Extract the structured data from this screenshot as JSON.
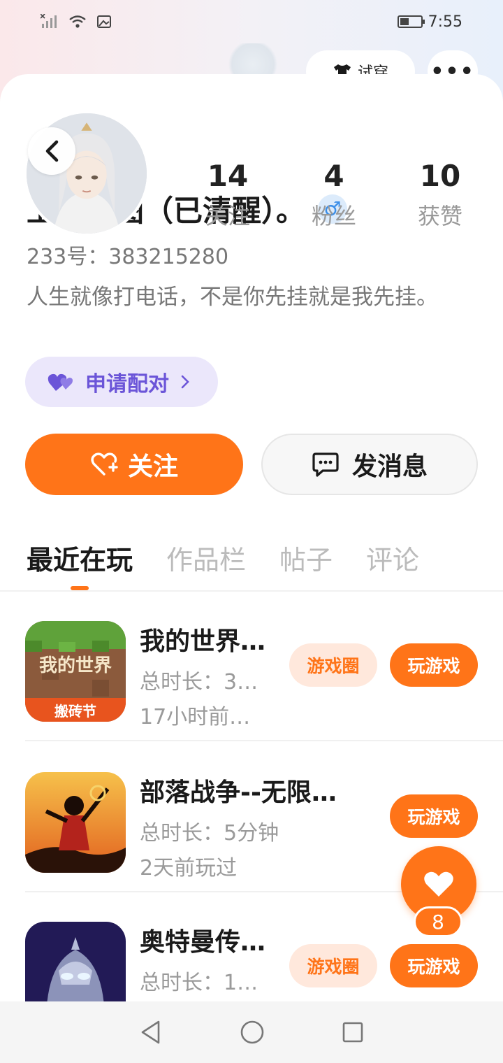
{
  "status_bar": {
    "time": "7:55"
  },
  "header": {
    "peek_pill_label": "试穿",
    "more_label": "•••"
  },
  "profile": {
    "stats": [
      {
        "value": "14",
        "label": "关注"
      },
      {
        "value": "4",
        "label": "粉丝"
      },
      {
        "value": "10",
        "label": "获赞"
      }
    ],
    "name": "上官修图（已清醒）。",
    "gender_symbol": "♂",
    "user_id": "233号：383215280",
    "bio": "人生就像打电话，不是你先挂就是我先挂。",
    "match_button": "申请配对",
    "follow_button": "关注",
    "message_button": "发消息"
  },
  "tabs": [
    {
      "label": "最近在玩",
      "active": true
    },
    {
      "label": "作品栏",
      "active": false
    },
    {
      "label": "帖子",
      "active": false
    },
    {
      "label": "评论",
      "active": false
    }
  ],
  "games": [
    {
      "title": "我的世界…",
      "duration": "总时长：3…",
      "last_played": "17小时前…",
      "circle_label": "游戏圈",
      "play_label": "玩游戏",
      "icon_text_top": "我的世界",
      "icon_text_bottom": "搬砖节"
    },
    {
      "title": "部落战争--无限…",
      "duration": "总时长：5分钟",
      "last_played": "2天前玩过",
      "circle_label": "",
      "play_label": "玩游戏"
    },
    {
      "title": "奥特曼传…",
      "duration": "总时长：1…",
      "last_played": "",
      "circle_label": "游戏圈",
      "play_label": "玩游戏"
    }
  ],
  "like_fab": {
    "count": "8"
  },
  "colors": {
    "accent": "#ff7418",
    "match_purple": "#6b55d8",
    "gender_blue": "#3b8ee8"
  }
}
